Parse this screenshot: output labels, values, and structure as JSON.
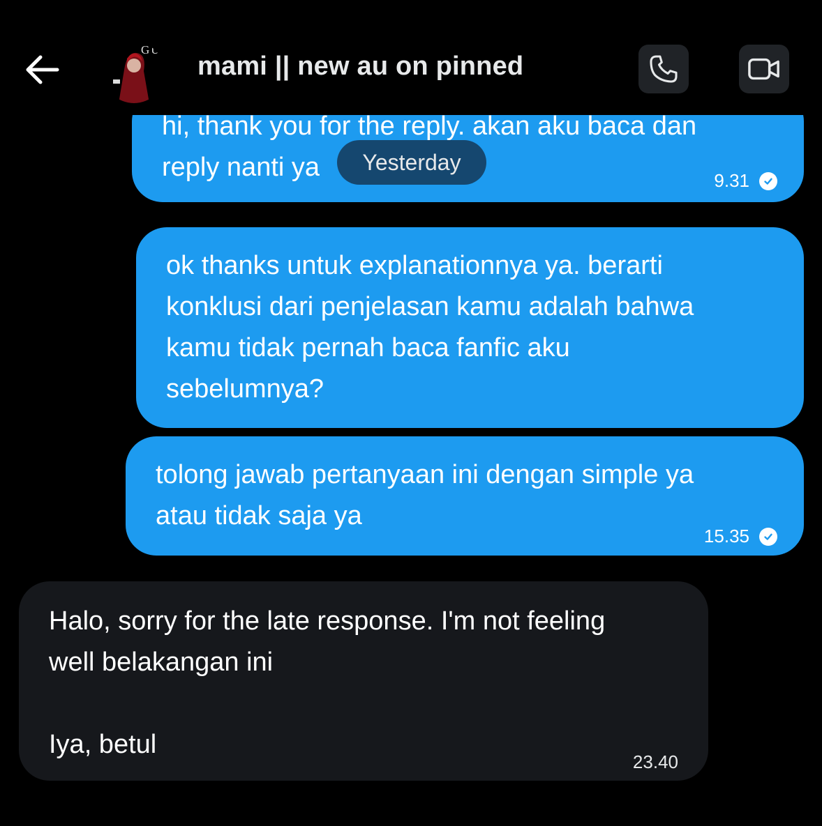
{
  "header": {
    "title": "mami || new au on pinned",
    "avatar_text": "GU",
    "back_icon": "arrow-left-icon",
    "call_icon": "phone-icon",
    "video_icon": "video-camera-icon"
  },
  "date_separator": "Yesterday",
  "messages": [
    {
      "direction": "outgoing",
      "text": "hi, thank you for the reply. akan aku baca dan\nreply nanti ya",
      "time": "9.31",
      "read": true
    },
    {
      "direction": "outgoing",
      "text": "ok thanks untuk explanationnya ya. berarti\nkonklusi dari penjelasan kamu adalah bahwa\nkamu tidak pernah baca fanfic aku\nsebelumnya?",
      "time": "",
      "read": false
    },
    {
      "direction": "outgoing",
      "text": "tolong jawab pertanyaan ini dengan simple ya\natau tidak saja ya",
      "time": "15.35",
      "read": true
    },
    {
      "direction": "incoming",
      "text": "Halo, sorry for the late response. I'm not feeling\nwell belakangan ini\n\nIya, betul",
      "time": "23.40",
      "read": false
    }
  ],
  "colors": {
    "background": "#000000",
    "outgoing_bubble": "#1d9bf0",
    "incoming_bubble": "#16181c",
    "date_pill": "#15476f",
    "header_button": "#202327"
  }
}
